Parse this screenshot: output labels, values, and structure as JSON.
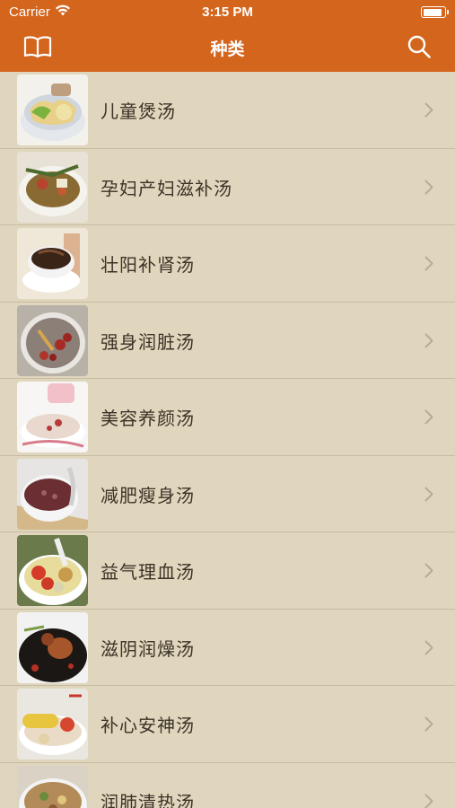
{
  "status_bar": {
    "carrier": "Carrier",
    "time": "3:15 PM",
    "battery_level": 0.95
  },
  "nav": {
    "title": "种类",
    "left_icon": "book-icon",
    "right_icon": "search-icon"
  },
  "colors": {
    "header": "#d4651d",
    "background": "#e0d6bd",
    "separator": "#c6bca3",
    "label": "#3a3226",
    "chevron": "#b7ad96"
  },
  "categories": [
    {
      "label": "儿童煲汤"
    },
    {
      "label": "孕妇产妇滋补汤"
    },
    {
      "label": "壮阳补肾汤"
    },
    {
      "label": "强身润脏汤"
    },
    {
      "label": "美容养颜汤"
    },
    {
      "label": "减肥瘦身汤"
    },
    {
      "label": "益气理血汤"
    },
    {
      "label": "滋阴润燥汤"
    },
    {
      "label": "补心安神汤"
    },
    {
      "label": "润肺清热汤"
    }
  ]
}
